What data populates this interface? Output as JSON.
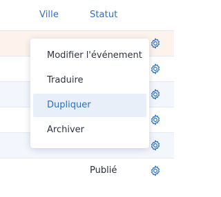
{
  "table": {
    "columns": [
      "Ville",
      "Statut"
    ],
    "rows": [
      {
        "status": ""
      },
      {
        "status": ""
      },
      {
        "status": ""
      },
      {
        "status": ""
      },
      {
        "status": "Publié"
      },
      {
        "status": "Publié"
      }
    ]
  },
  "menu": {
    "items": [
      "Modifier l'événement",
      "Traduire",
      "Dupliquer",
      "Archiver"
    ],
    "highlighted": "Dupliquer"
  },
  "colors": {
    "accent": "#2a6fc0",
    "row_highlight": "#fdf3ec",
    "row_alt": "#f3f6fd",
    "menu_hover": "#e9eff8"
  },
  "icons": {
    "row_action": "gear-icon"
  }
}
